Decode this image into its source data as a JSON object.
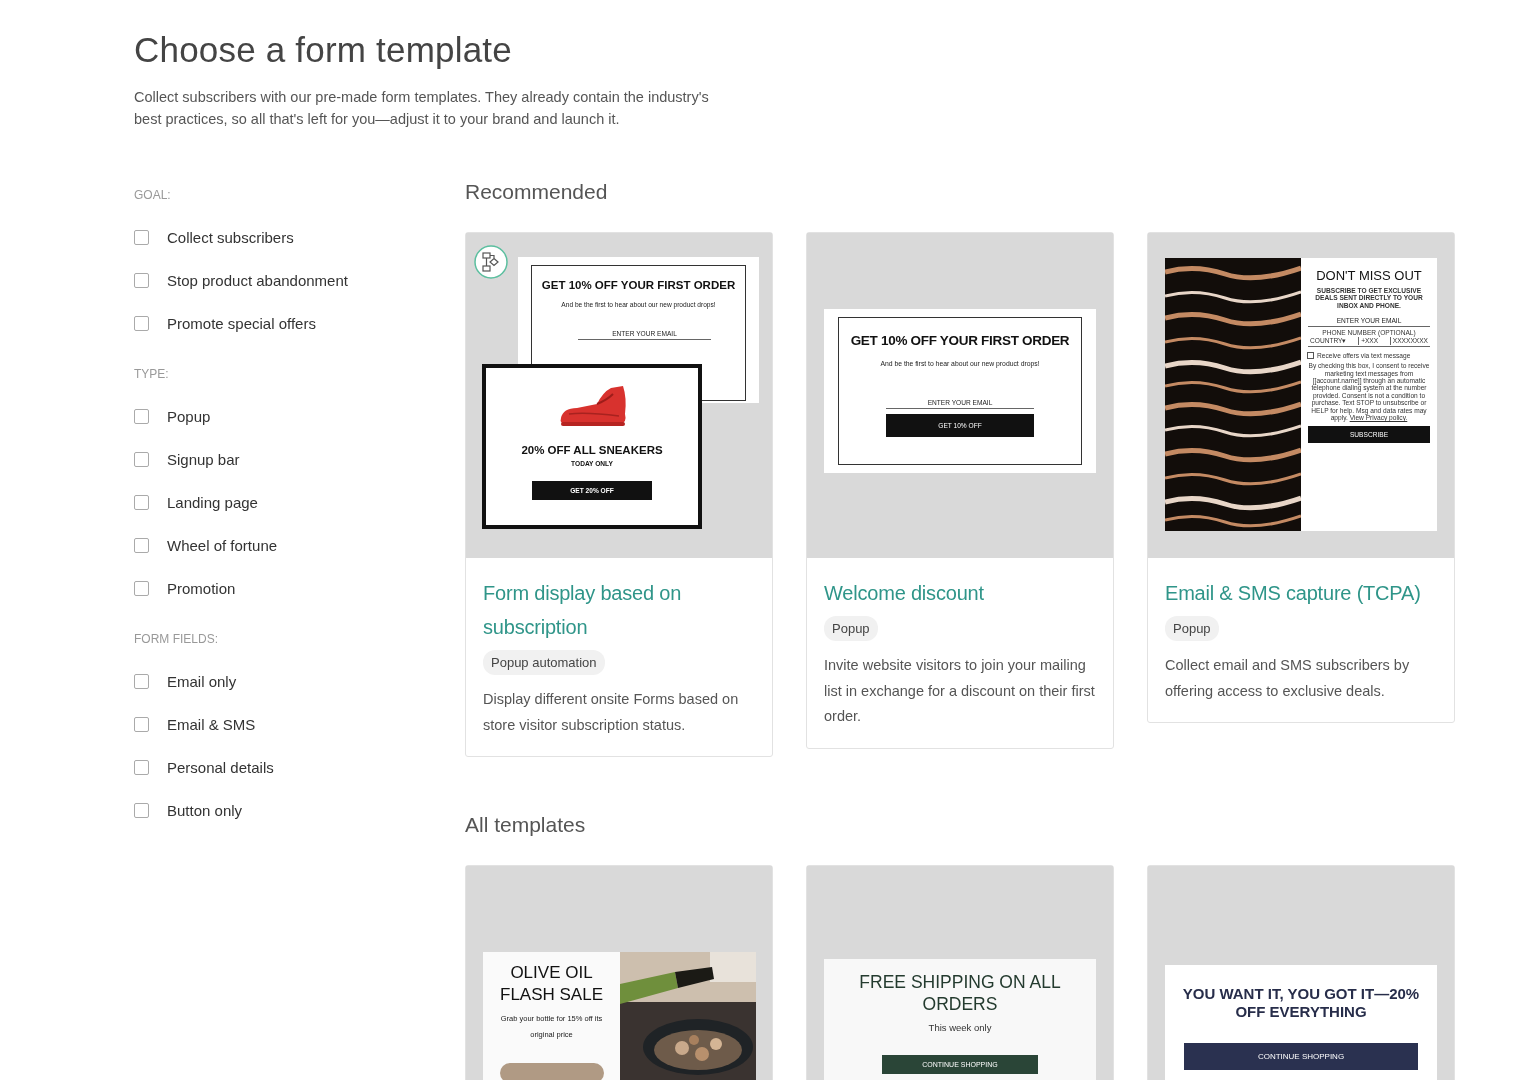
{
  "header": {
    "title": "Choose a form template",
    "description": "Collect subscribers with our pre-made form templates. They already contain the industry's best practices, so all that's left for you—adjust it to your brand and launch it."
  },
  "filters": [
    {
      "heading": "GOAL:",
      "options": [
        {
          "label": "Collect subscribers",
          "checked": false
        },
        {
          "label": "Stop product abandonment",
          "checked": false
        },
        {
          "label": "Promote special offers",
          "checked": false
        }
      ]
    },
    {
      "heading": "TYPE:",
      "options": [
        {
          "label": "Popup",
          "checked": false
        },
        {
          "label": "Signup bar",
          "checked": false
        },
        {
          "label": "Landing page",
          "checked": false
        },
        {
          "label": "Wheel of fortune",
          "checked": false
        },
        {
          "label": "Promotion",
          "checked": false
        }
      ]
    },
    {
      "heading": "FORM FIELDS:",
      "options": [
        {
          "label": "Email only",
          "checked": false
        },
        {
          "label": "Email & SMS",
          "checked": false
        },
        {
          "label": "Personal details",
          "checked": false
        },
        {
          "label": "Button only",
          "checked": false
        }
      ]
    }
  ],
  "sections": [
    {
      "title": "Recommended",
      "cards": [
        {
          "preview": {
            "kind": "stacked",
            "badge": true,
            "back": {
              "heading": "GET 10% OFF YOUR FIRST ORDER",
              "subtext": "And be the first to hear about our new product drops!",
              "email_label": "ENTER YOUR EMAIL"
            },
            "front": {
              "heading": "20% OFF ALL SNEAKERS",
              "subheading": "TODAY ONLY",
              "button": "GET 20% OFF"
            }
          },
          "title": "Form display based on subscription",
          "tag": "Popup automation",
          "description": "Display different onsite Forms based on store visitor subscription status."
        },
        {
          "preview": {
            "kind": "popup",
            "heading": "GET 10% OFF YOUR FIRST ORDER",
            "subtext": "And be the first to hear about our new product drops!",
            "email_label": "ENTER YOUR EMAIL",
            "button": "GET 10% OFF"
          },
          "title": "Welcome discount",
          "tag": "Popup",
          "description": "Invite website visitors to join your mailing list in exchange for a discount on their first order."
        },
        {
          "preview": {
            "kind": "image_split",
            "heading": "DON'T MISS OUT",
            "subtext": "SUBSCRIBE TO GET EXCLUSIVE DEALS SENT DIRECTLY TO YOUR INBOX AND PHONE.",
            "email_label": "ENTER YOUR EMAIL",
            "phone_label": "PHONE NUMBER (OPTIONAL)",
            "country": "COUNTRY▾",
            "code": "+XXX",
            "number": "XXXXXXXX",
            "checkbox_label": "Receive offers via text message",
            "checked": false,
            "consent": "By checking this box, I consent to receive marketing text messages from [[account.name]] through an automatic telephone dialing system at the number provided. Consent is not a condition to purchase. Text STOP to unsubscribe or HELP for help. Msg and data rates may apply.",
            "consent_link": "View Privacy policy.",
            "button": "SUBSCRIBE"
          },
          "title": "Email & SMS capture (TCPA)",
          "tag": "Popup",
          "description": "Collect email and SMS subscribers by offering access to exclusive deals."
        }
      ]
    },
    {
      "title": "All templates",
      "cards": [
        {
          "preview": {
            "kind": "image_right",
            "heading": "OLIVE OIL FLASH SALE",
            "subtext": "Grab your bottle for 15% off its original price"
          }
        },
        {
          "preview": {
            "kind": "banner_light",
            "heading": "FREE SHIPPING ON ALL ORDERS",
            "subtext": "This week only",
            "button": "CONTINUE SHOPPING"
          }
        },
        {
          "preview": {
            "kind": "banner_bold",
            "heading": "YOU WANT IT, YOU GOT IT—20% OFF EVERYTHING",
            "button": "CONTINUE SHOPPING"
          }
        }
      ]
    }
  ]
}
